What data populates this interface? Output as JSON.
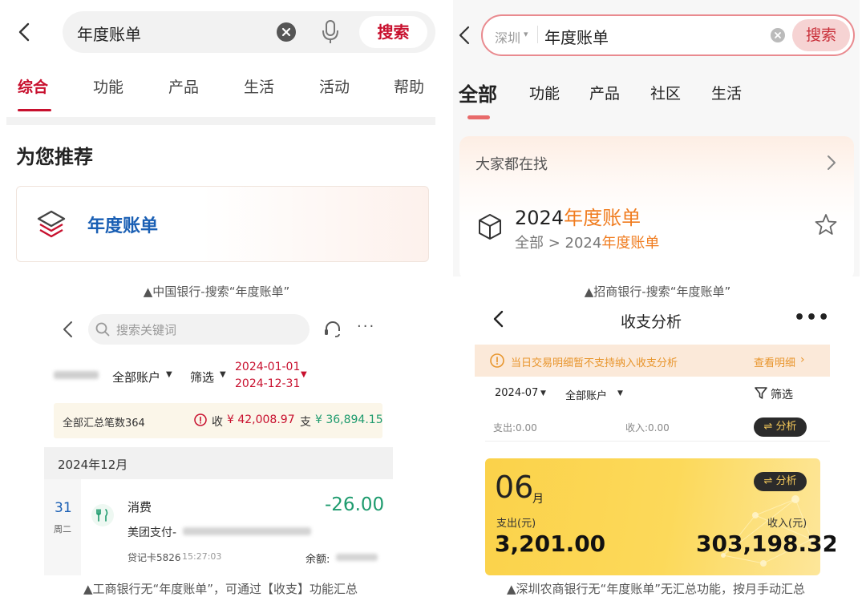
{
  "boc": {
    "search_value": "年度账单",
    "search_button": "搜索",
    "tabs": [
      "综合",
      "功能",
      "产品",
      "生活",
      "活动",
      "帮助"
    ],
    "active_tab_color": "#c8102e",
    "section_title": "为您推荐",
    "recommend_item": "年度账单",
    "caption": "▲中国银行-搜索“年度账单”"
  },
  "cmb": {
    "city": "深圳",
    "search_value": "年度账单",
    "search_button": "搜索",
    "tabs": [
      "全部",
      "功能",
      "产品",
      "社区",
      "生活"
    ],
    "card_header": "大家都在找",
    "result_prefix": "2024",
    "result_highlight": "年度账单",
    "result_path_prefix": "全部 > 2024",
    "result_path_highlight": "年度账单",
    "highlight_color": "#f07c1f",
    "caption": "▲招商银行-搜索“年度账单”"
  },
  "icbc": {
    "search_placeholder": "搜索关键词",
    "account_filter": "全部账户",
    "filter_label": "筛选",
    "date_start": "2024-01-01",
    "date_end": "2024-12-31",
    "summary_count": "全部汇总笔数364",
    "income_label": "收",
    "income_value": "¥ 42,008.97",
    "expense_label": "支",
    "expense_value": "¥ 36,894.15",
    "month_header": "2024年12月",
    "transaction": {
      "day": "31",
      "weekday": "周二",
      "type": "消费",
      "merchant": "美团支付-",
      "card": "贷记卡5826",
      "time": "15:27:03",
      "amount": "-26.00",
      "balance_label": "余额:"
    },
    "caption": "▲工商银行无“年度账单”，可通过【收支】功能汇总"
  },
  "srcb": {
    "title": "收支分析",
    "notice": "当日交易明细暂不支持纳入收支分析",
    "notice_link": "查看明细",
    "month_filter": "2024-07",
    "account_filter": "全部账户",
    "filter_label": "筛选",
    "expense_summary": "支出:0.00",
    "income_summary": "收入:0.00",
    "analysis_button": "⇌ 分析",
    "card_month": "06",
    "card_month_unit": "月",
    "card_analysis_button": "⇌ 分析",
    "card_expense_label": "支出(元)",
    "card_expense_value": "3,201.00",
    "card_income_label": "收入(元)",
    "card_income_value": "303,198.32",
    "caption": "▲深圳农商银行无“年度账单”无汇总功能，按月手动汇总"
  }
}
